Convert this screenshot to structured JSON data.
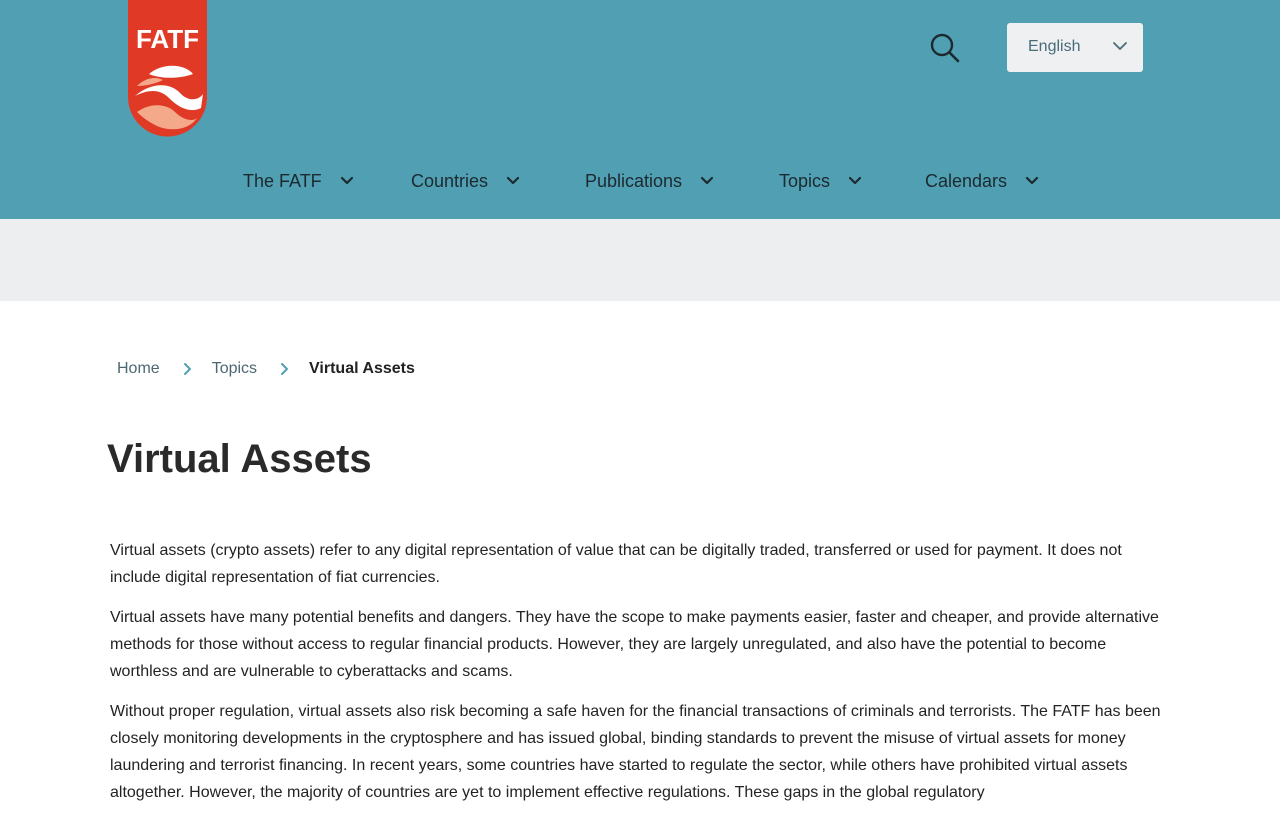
{
  "header": {
    "logo_text": "FATF",
    "search_label": "Search",
    "language": {
      "selected": "English"
    },
    "nav": [
      {
        "label": "The FATF"
      },
      {
        "label": "Countries"
      },
      {
        "label": "Publications"
      },
      {
        "label": "Topics"
      },
      {
        "label": "Calendars"
      }
    ]
  },
  "breadcrumb": {
    "items": [
      {
        "label": "Home"
      },
      {
        "label": "Topics"
      }
    ],
    "current": "Virtual Assets"
  },
  "page": {
    "title": "Virtual Assets",
    "paragraphs": [
      "Virtual assets (crypto assets) refer to any digital representation of value that can be digitally traded, transferred or used for payment. It does not include digital representation of fiat currencies.",
      "Virtual assets have many potential benefits and dangers. They have the scope to make payments easier, faster and cheaper, and provide alternative methods for those without access to regular financial products. However, they are largely unregulated, and also have the potential to become worthless and are vulnerable to cyberattacks and scams.",
      "Without proper regulation, virtual assets also risk becoming a safe haven for the financial transactions of criminals and terrorists. The FATF has been closely monitoring developments in the cryptosphere and has issued global, binding standards to prevent the misuse of virtual assets for money laundering and terrorist financing. In recent years, some countries have started to regulate the sector, while others have prohibited virtual assets altogether. However, the majority of countries are yet to implement effective regulations. These gaps in the global regulatory"
    ]
  },
  "colors": {
    "header_bg": "#519fb2",
    "logo_red": "#e03a27",
    "banner_bg": "#edeef0",
    "accent": "#519fb2"
  },
  "icons": {
    "search": "search-icon",
    "chevron": "chevron-down-icon",
    "separator": "chevron-right-icon"
  }
}
